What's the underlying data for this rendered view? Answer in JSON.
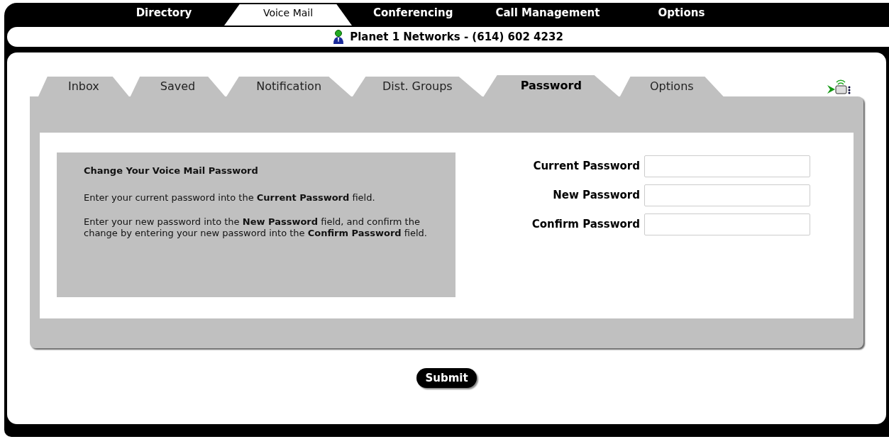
{
  "nav": [
    {
      "label": "Directory",
      "selected": false
    },
    {
      "label": "Voice Mail",
      "selected": true
    },
    {
      "label": "Conferencing",
      "selected": false
    },
    {
      "label": "Call Management",
      "selected": false
    },
    {
      "label": "Options",
      "selected": false
    }
  ],
  "header": {
    "title": "Planet 1 Networks - (614) 602 4232"
  },
  "tabs": [
    {
      "label": "Inbox",
      "selected": false
    },
    {
      "label": "Saved",
      "selected": false
    },
    {
      "label": "Notification",
      "selected": false
    },
    {
      "label": "Dist. Groups",
      "selected": false
    },
    {
      "label": "Password",
      "selected": true
    },
    {
      "label": "Options",
      "selected": false
    }
  ],
  "info": {
    "title": "Change Your Voice Mail Password",
    "paragraphs": [
      "Enter your current password into the **Current Password** field.",
      "Enter your new password into the **New Password** field, and confirm the change by entering your new password into the **Confirm Password** field."
    ]
  },
  "fields": [
    {
      "label": "Current Password"
    },
    {
      "label": "New Password"
    },
    {
      "label": "Confirm Password"
    }
  ],
  "submit": "Submit"
}
